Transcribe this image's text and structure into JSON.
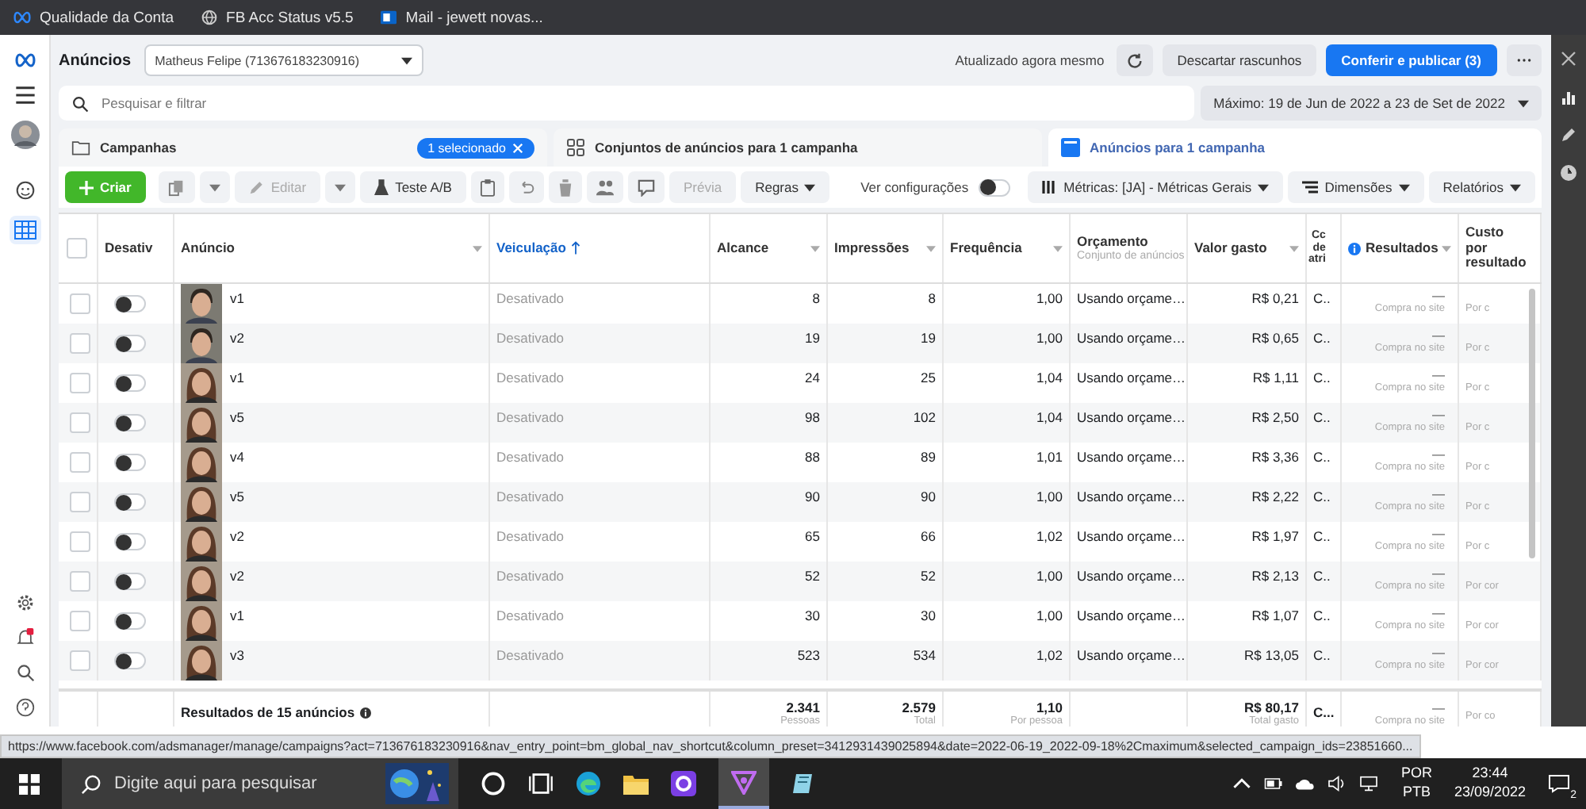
{
  "bookmarks": [
    {
      "label": "Qualidade da Conta"
    },
    {
      "label": "FB Acc Status v5.5"
    },
    {
      "label": "Mail - jewett novas..."
    }
  ],
  "header": {
    "title": "Anúncios",
    "account": "Matheus Felipe (713676183230916)",
    "updated": "Atualizado agora mesmo",
    "discard": "Descartar rascunhos",
    "publish": "Conferir e publicar (3)"
  },
  "search": {
    "placeholder": "Pesquisar e filtrar"
  },
  "date_range": "Máximo: 19 de Jun de 2022 a 23 de Set de 2022",
  "tabs": [
    {
      "label": "Campanhas",
      "badge": "1 selecionado",
      "selected": false
    },
    {
      "label": "Conjuntos de anúncios para 1 campanha",
      "selected": false
    },
    {
      "label": "Anúncios para 1 campanha",
      "selected": true
    }
  ],
  "toolbar": {
    "create": "Criar",
    "edit": "Editar",
    "edit_disabled": true,
    "ab_test": "Teste A/B",
    "preview": "Prévia",
    "preview_disabled": true,
    "rules": "Regras",
    "view_settings": "Ver configurações",
    "view_settings_on": false,
    "metrics": "Métricas: [JA] - Métricas Gerais",
    "dimensions": "Dimensões",
    "reports": "Relatórios"
  },
  "table": {
    "all_checked": false,
    "columns": [
      {
        "label": "Desativ",
        "menu": false,
        "sorted": false
      },
      {
        "label": "Anúncio",
        "menu": true,
        "sorted": false
      },
      {
        "label": "Veiculação",
        "menu": false,
        "sorted": true
      },
      {
        "label": "Alcance",
        "menu": true,
        "sorted": false
      },
      {
        "label": "Impressões",
        "menu": true,
        "sorted": false
      },
      {
        "label": "Frequência",
        "menu": true,
        "sorted": false
      },
      {
        "label": "Orçamento",
        "sub": "Conjunto de anúncios",
        "menu": false,
        "sorted": false
      },
      {
        "label": "Valor gasto",
        "menu": true,
        "sorted": false
      },
      {
        "label": "Cc de atri",
        "menu": false,
        "sorted": false
      },
      {
        "label": "Resultados",
        "info": true,
        "menu": true,
        "sorted": false
      },
      {
        "label": "Custo por resultado",
        "menu": false,
        "sorted": false
      }
    ],
    "rows": [
      {
        "checked": false,
        "on": false,
        "name": "v1",
        "delivery": "Desativado",
        "reach": "8",
        "impressions": "8",
        "frequency": "1,00",
        "budget": "Usando orçame…",
        "spent": "R$ 0,21",
        "column_cc": "C..",
        "results": "—",
        "results_type": "Compra no site",
        "cost": "Por c"
      },
      {
        "checked": false,
        "on": false,
        "name": "v2",
        "delivery": "Desativado",
        "reach": "19",
        "impressions": "19",
        "frequency": "1,00",
        "budget": "Usando orçame…",
        "spent": "R$ 0,65",
        "column_cc": "C..",
        "results": "—",
        "results_type": "Compra no site",
        "cost": "Por c"
      },
      {
        "checked": false,
        "on": false,
        "name": "v1",
        "delivery": "Desativado",
        "reach": "24",
        "impressions": "25",
        "frequency": "1,04",
        "budget": "Usando orçame…",
        "spent": "R$ 1,11",
        "column_cc": "C..",
        "results": "—",
        "results_type": "Compra no site",
        "cost": "Por c"
      },
      {
        "checked": false,
        "on": false,
        "name": "v5",
        "delivery": "Desativado",
        "reach": "98",
        "impressions": "102",
        "frequency": "1,04",
        "budget": "Usando orçame…",
        "spent": "R$ 2,50",
        "column_cc": "C..",
        "results": "—",
        "results_type": "Compra no site",
        "cost": "Por c"
      },
      {
        "checked": false,
        "on": false,
        "name": "v4",
        "delivery": "Desativado",
        "reach": "88",
        "impressions": "89",
        "frequency": "1,01",
        "budget": "Usando orçame…",
        "spent": "R$ 3,36",
        "column_cc": "C..",
        "results": "—",
        "results_type": "Compra no site",
        "cost": "Por c"
      },
      {
        "checked": false,
        "on": false,
        "name": "v5",
        "delivery": "Desativado",
        "reach": "90",
        "impressions": "90",
        "frequency": "1,00",
        "budget": "Usando orçame…",
        "spent": "R$ 2,22",
        "column_cc": "C..",
        "results": "—",
        "results_type": "Compra no site",
        "cost": "Por c"
      },
      {
        "checked": false,
        "on": false,
        "name": "v2",
        "delivery": "Desativado",
        "reach": "65",
        "impressions": "66",
        "frequency": "1,02",
        "budget": "Usando orçame…",
        "spent": "R$ 1,97",
        "column_cc": "C..",
        "results": "—",
        "results_type": "Compra no site",
        "cost": "Por c"
      },
      {
        "checked": false,
        "on": false,
        "name": "v2",
        "delivery": "Desativado",
        "reach": "52",
        "impressions": "52",
        "frequency": "1,00",
        "budget": "Usando orçame…",
        "spent": "R$ 2,13",
        "column_cc": "C..",
        "results": "—",
        "results_type": "Compra no site",
        "cost": "Por cor"
      },
      {
        "checked": false,
        "on": false,
        "name": "v1",
        "delivery": "Desativado",
        "reach": "30",
        "impressions": "30",
        "frequency": "1,00",
        "budget": "Usando orçame…",
        "spent": "R$ 1,07",
        "column_cc": "C..",
        "results": "—",
        "results_type": "Compra no site",
        "cost": "Por cor"
      },
      {
        "checked": false,
        "on": false,
        "name": "v3",
        "delivery": "Desativado",
        "reach": "523",
        "impressions": "534",
        "frequency": "1,02",
        "budget": "Usando orçame…",
        "spent": "R$ 13,05",
        "column_cc": "C..",
        "results": "—",
        "results_type": "Compra no site",
        "cost": "Por cor"
      }
    ],
    "summary": {
      "label": "Resultados de 15 anúncios",
      "reach": "2.341",
      "reach_sub": "Pessoas",
      "impressions": "2.579",
      "impressions_sub": "Total",
      "frequency": "1,10",
      "frequency_sub": "Por pessoa",
      "spent": "R$ 80,17",
      "spent_sub": "Total gasto",
      "column_cc": "C...",
      "results": "—",
      "results_type": "Compra no site",
      "cost": "Por co"
    }
  },
  "status_url": "https://www.facebook.com/adsmanager/manage/campaigns?act=713676183230916&nav_entry_point=bm_global_nav_shortcut&column_preset=3412931439025894&date=2022-06-19_2022-09-18%2Cmaximum&selected_campaign_ids=23851660...",
  "taskbar": {
    "search_placeholder": "Digite aqui para pesquisar",
    "language": "POR",
    "layout": "PTB",
    "time": "23:44",
    "date": "23/09/2022",
    "notifications": "2"
  }
}
